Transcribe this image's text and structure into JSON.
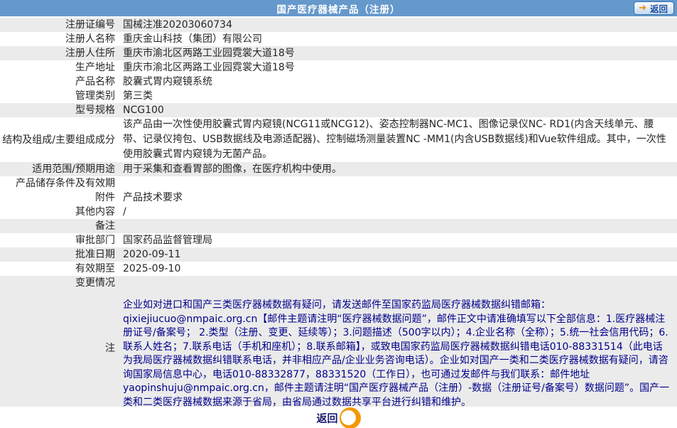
{
  "header": {
    "title": "国产医疗器械产品（注册）",
    "back_label": "返回",
    "back_arrow": "➜",
    "bg_color": "#6598CB"
  },
  "rows": [
    {
      "label": "注册证编号",
      "value": "国械注准20203060734"
    },
    {
      "label": "注册人名称",
      "value": "重庆金山科技（集团）有限公司"
    },
    {
      "label": "注册人住所",
      "value": "重庆市渝北区两路工业园霓裳大道18号"
    },
    {
      "label": "生产地址",
      "value": "重庆市渝北区两路工业园霓裳大道18号"
    },
    {
      "label": "产品名称",
      "value": "胶囊式胃内窥镜系统"
    },
    {
      "label": "管理类别",
      "value": "第三类"
    },
    {
      "label": "型号规格",
      "value": "NCG100"
    },
    {
      "label": "结构及组成/主要组成成分",
      "value": "该产品由一次性使用胶囊式胃内窥镜(NCG11或NCG12)、姿态控制器NC-MC1、图像记录仪NC- RD1(内含天线单元、腰带、记录仪挎包、USB数据线及电源适配器)、控制磁场测量装置NC -MM1(内含USB数据线)和Vue软件组成。其中，一次性使用胶囊式胃内窥镜为无菌产品。"
    },
    {
      "label": "适用范围/预期用途",
      "value": "用于采集和查看胃部的图像，在医疗机构中使用。"
    },
    {
      "label": "产品储存条件及有效期",
      "value": ""
    },
    {
      "label": "附件",
      "value": "产品技术要求"
    },
    {
      "label": "其他内容",
      "value": "/"
    },
    {
      "label": "备注",
      "value": ""
    },
    {
      "label": "审批部门",
      "value": "国家药品监督管理局"
    },
    {
      "label": "批准日期",
      "value": "2020-09-11"
    },
    {
      "label": "有效期至",
      "value": "2025-09-10"
    },
    {
      "label": "变更情况",
      "value": ""
    },
    {
      "label": "注",
      "value": "企业如对进口和国产三类医疗器械数据有疑问，请发送邮件至国家药监局医疗器械数据纠错邮箱：qixiejiucuo@nmpaic.org.cn【邮件主题请注明“医疗器械数据问题”，邮件正文中请准确填写以下全部信息：1.医疗器械注册证号/备案号； 2.类型（注册、变更、延续等）；3.问题描述（500字以内）；4.企业名称（全称）；5.统一社会信用代码；6.联系人姓名；7.联系电话（手机和座机）；8.联系邮箱】，或致电国家药监局医疗器械数据纠错电话010-88331514（此电话为我局医疗器械数据纠错联系电话，并非相应产品/企业业务咨询电话）。企业如对国产一类和二类医疗器械数据有疑问，请咨询国家局信息中心，电话010-88332877，88331520（工作日），也可通过发邮件与我们联系：邮件地址yaopinshuju@nmpaic.org.cn，邮件主题请注明“国产医疗器械产品（注册）-数据（注册证号/备案号）数据问题”。国产一类和二类医疗器械数据来源于省局，由省局通过数据共享平台进行纠错和维护。"
    }
  ],
  "footer": {
    "back_label": "返回"
  },
  "colors": {
    "header_bg": "#6598CB",
    "row_shade": "#EBEBEB",
    "note_text": "#00008B",
    "accent_orange": "#F39800",
    "back_button_text": "#1D4E9E"
  }
}
